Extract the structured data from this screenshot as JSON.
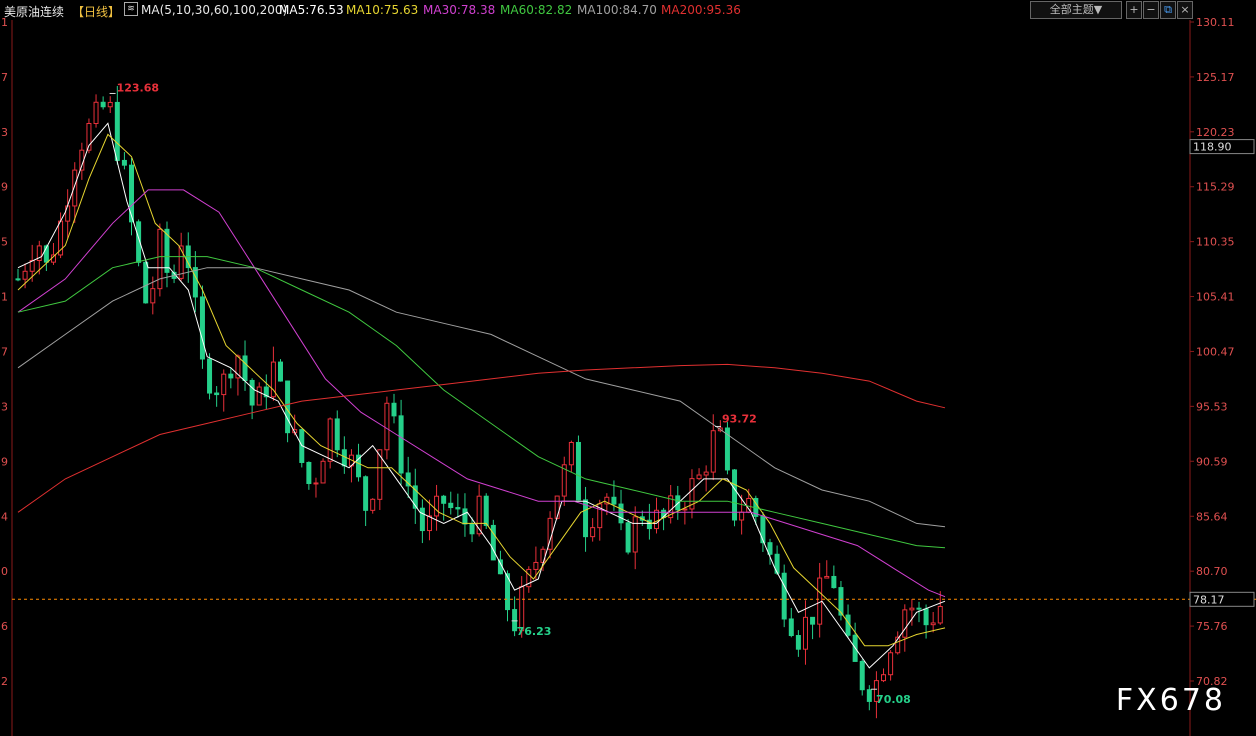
{
  "header": {
    "symbol": "美原油连续",
    "period": "【日线】",
    "ma_spec": "MA(5,10,30,60,100,200)",
    "ma5": "MA5:76.53",
    "ma10": "MA10:75.63",
    "ma30": "MA30:78.38",
    "ma60": "MA60:82.82",
    "ma100": "MA100:84.70",
    "ma200": "MA200:95.36"
  },
  "toolbar": {
    "theme_select": "全部主题▼",
    "zoom_in": "+",
    "zoom_out": "−",
    "restore": "⧉",
    "close": "×"
  },
  "colors": {
    "up": "#e8303a",
    "down": "#25d08a",
    "ma5": "#ffffff",
    "ma10": "#e6d530",
    "ma30": "#d040d0",
    "ma60": "#40c840",
    "ma100": "#a0a0a0",
    "ma200": "#e03030",
    "axis_text": "#e05050",
    "current_line": "#ff8c00"
  },
  "chart_data": {
    "type": "candlestick",
    "y_ticks": [
      "130.11",
      "125.17",
      "120.23",
      "115.29",
      "110.35",
      "105.41",
      "100.47",
      "95.53",
      "90.59",
      "85.64",
      "80.70",
      "75.76",
      "70.82"
    ],
    "ylim": [
      69.5,
      131.0
    ],
    "left_ticks": [
      "1",
      "7",
      "3",
      "9",
      "5",
      "1",
      "7",
      "3",
      "9",
      "4",
      "0",
      "6",
      "2"
    ],
    "markers": [
      {
        "label": "123.68",
        "value": 123.68
      },
      {
        "label": "93.72",
        "value": 93.72
      },
      {
        "label": "76.23",
        "value": 76.23
      },
      {
        "label": "70.08",
        "value": 70.08
      }
    ],
    "price_boxes": [
      {
        "label": "118.90",
        "value": 118.9
      },
      {
        "label": "78.17",
        "value": 78.17
      }
    ],
    "current_price": 78.17,
    "trend_points": [
      [
        0,
        107
      ],
      [
        8,
        111
      ],
      [
        12,
        108
      ],
      [
        18,
        112
      ],
      [
        25,
        119
      ],
      [
        32,
        121
      ],
      [
        38,
        123
      ],
      [
        45,
        116
      ],
      [
        50,
        109
      ],
      [
        55,
        104
      ],
      [
        60,
        110
      ],
      [
        65,
        106
      ],
      [
        70,
        112
      ],
      [
        78,
        99
      ],
      [
        86,
        97
      ],
      [
        92,
        101
      ],
      [
        100,
        95
      ],
      [
        108,
        99
      ],
      [
        116,
        93
      ],
      [
        124,
        88
      ],
      [
        132,
        94
      ],
      [
        140,
        91
      ],
      [
        148,
        86
      ],
      [
        156,
        96
      ],
      [
        164,
        89
      ],
      [
        172,
        84
      ],
      [
        180,
        87
      ],
      [
        188,
        85
      ],
      [
        196,
        86
      ],
      [
        204,
        79
      ],
      [
        210,
        76.2
      ],
      [
        218,
        81
      ],
      [
        226,
        87
      ],
      [
        234,
        91
      ],
      [
        240,
        85
      ],
      [
        248,
        88
      ],
      [
        256,
        83
      ],
      [
        264,
        86
      ],
      [
        272,
        85
      ],
      [
        280,
        87
      ],
      [
        288,
        89
      ],
      [
        296,
        93.7
      ],
      [
        302,
        86
      ],
      [
        310,
        87
      ],
      [
        318,
        82
      ],
      [
        324,
        78
      ],
      [
        330,
        75
      ],
      [
        336,
        77
      ],
      [
        344,
        81
      ],
      [
        350,
        74
      ],
      [
        356,
        71
      ],
      [
        362,
        70.1
      ],
      [
        368,
        74
      ],
      [
        376,
        78
      ],
      [
        384,
        76
      ],
      [
        392,
        78.2
      ]
    ],
    "ma_series": [
      {
        "name": "MA5",
        "color_key": "ma5",
        "points": [
          [
            0,
            108
          ],
          [
            10,
            109
          ],
          [
            20,
            113
          ],
          [
            30,
            119
          ],
          [
            38,
            121
          ],
          [
            46,
            114
          ],
          [
            55,
            108
          ],
          [
            64,
            108
          ],
          [
            72,
            106
          ],
          [
            80,
            100
          ],
          [
            90,
            99
          ],
          [
            100,
            97
          ],
          [
            110,
            96
          ],
          [
            120,
            92
          ],
          [
            130,
            91
          ],
          [
            140,
            90
          ],
          [
            150,
            92
          ],
          [
            160,
            89
          ],
          [
            170,
            86
          ],
          [
            180,
            85
          ],
          [
            190,
            86
          ],
          [
            200,
            83
          ],
          [
            210,
            79
          ],
          [
            220,
            80
          ],
          [
            230,
            87
          ],
          [
            240,
            87
          ],
          [
            250,
            86
          ],
          [
            260,
            85
          ],
          [
            270,
            85
          ],
          [
            280,
            87
          ],
          [
            290,
            89
          ],
          [
            300,
            89
          ],
          [
            310,
            86
          ],
          [
            320,
            81
          ],
          [
            330,
            77
          ],
          [
            340,
            78
          ],
          [
            350,
            75
          ],
          [
            360,
            72
          ],
          [
            370,
            74
          ],
          [
            380,
            77
          ],
          [
            392,
            78
          ]
        ]
      },
      {
        "name": "MA10",
        "color_key": "ma10",
        "points": [
          [
            0,
            106
          ],
          [
            10,
            108
          ],
          [
            20,
            110
          ],
          [
            30,
            116
          ],
          [
            38,
            120
          ],
          [
            48,
            118
          ],
          [
            58,
            112
          ],
          [
            68,
            110
          ],
          [
            78,
            106
          ],
          [
            88,
            101
          ],
          [
            98,
            99
          ],
          [
            108,
            97
          ],
          [
            118,
            94
          ],
          [
            128,
            92
          ],
          [
            138,
            91
          ],
          [
            148,
            90
          ],
          [
            158,
            90
          ],
          [
            168,
            88
          ],
          [
            178,
            86
          ],
          [
            188,
            85
          ],
          [
            198,
            85
          ],
          [
            208,
            82
          ],
          [
            218,
            80
          ],
          [
            228,
            83
          ],
          [
            238,
            86
          ],
          [
            248,
            87
          ],
          [
            258,
            86
          ],
          [
            268,
            85
          ],
          [
            278,
            86
          ],
          [
            288,
            87
          ],
          [
            298,
            89
          ],
          [
            308,
            88
          ],
          [
            318,
            85
          ],
          [
            328,
            81
          ],
          [
            338,
            79
          ],
          [
            348,
            77
          ],
          [
            358,
            74
          ],
          [
            368,
            74
          ],
          [
            380,
            75
          ],
          [
            392,
            75.6
          ]
        ]
      },
      {
        "name": "MA30",
        "color_key": "ma30",
        "points": [
          [
            0,
            104
          ],
          [
            20,
            107
          ],
          [
            40,
            112
          ],
          [
            55,
            115
          ],
          [
            70,
            115
          ],
          [
            85,
            113
          ],
          [
            100,
            108
          ],
          [
            115,
            103
          ],
          [
            130,
            98
          ],
          [
            145,
            95
          ],
          [
            160,
            93
          ],
          [
            175,
            91
          ],
          [
            190,
            89
          ],
          [
            205,
            88
          ],
          [
            220,
            87
          ],
          [
            235,
            87
          ],
          [
            250,
            86
          ],
          [
            265,
            86
          ],
          [
            280,
            86
          ],
          [
            295,
            86
          ],
          [
            310,
            86
          ],
          [
            325,
            85
          ],
          [
            340,
            84
          ],
          [
            355,
            83
          ],
          [
            370,
            81
          ],
          [
            385,
            79
          ],
          [
            392,
            78.4
          ]
        ]
      },
      {
        "name": "MA60",
        "color_key": "ma60",
        "points": [
          [
            0,
            104
          ],
          [
            20,
            105
          ],
          [
            40,
            108
          ],
          [
            60,
            109
          ],
          [
            80,
            109
          ],
          [
            100,
            108
          ],
          [
            120,
            106
          ],
          [
            140,
            104
          ],
          [
            160,
            101
          ],
          [
            180,
            97
          ],
          [
            200,
            94
          ],
          [
            220,
            91
          ],
          [
            240,
            89
          ],
          [
            260,
            88
          ],
          [
            280,
            87
          ],
          [
            300,
            87
          ],
          [
            320,
            86
          ],
          [
            340,
            85
          ],
          [
            360,
            84
          ],
          [
            380,
            83
          ],
          [
            392,
            82.8
          ]
        ]
      },
      {
        "name": "MA100",
        "color_key": "ma100",
        "points": [
          [
            0,
            99
          ],
          [
            20,
            102
          ],
          [
            40,
            105
          ],
          [
            60,
            107
          ],
          [
            80,
            108
          ],
          [
            100,
            108
          ],
          [
            120,
            107
          ],
          [
            140,
            106
          ],
          [
            160,
            104
          ],
          [
            180,
            103
          ],
          [
            200,
            102
          ],
          [
            220,
            100
          ],
          [
            240,
            98
          ],
          [
            260,
            97
          ],
          [
            280,
            96
          ],
          [
            300,
            93
          ],
          [
            320,
            90
          ],
          [
            340,
            88
          ],
          [
            360,
            87
          ],
          [
            380,
            85
          ],
          [
            392,
            84.7
          ]
        ]
      },
      {
        "name": "MA200",
        "color_key": "ma200",
        "points": [
          [
            0,
            86
          ],
          [
            20,
            89
          ],
          [
            40,
            91
          ],
          [
            60,
            93
          ],
          [
            80,
            94
          ],
          [
            100,
            95
          ],
          [
            120,
            96
          ],
          [
            140,
            96.5
          ],
          [
            160,
            97
          ],
          [
            180,
            97.5
          ],
          [
            200,
            98
          ],
          [
            220,
            98.5
          ],
          [
            240,
            98.8
          ],
          [
            260,
            99
          ],
          [
            280,
            99.2
          ],
          [
            300,
            99.3
          ],
          [
            320,
            99
          ],
          [
            340,
            98.5
          ],
          [
            360,
            97.8
          ],
          [
            380,
            96
          ],
          [
            392,
            95.4
          ]
        ]
      }
    ]
  },
  "watermark": "FX678"
}
